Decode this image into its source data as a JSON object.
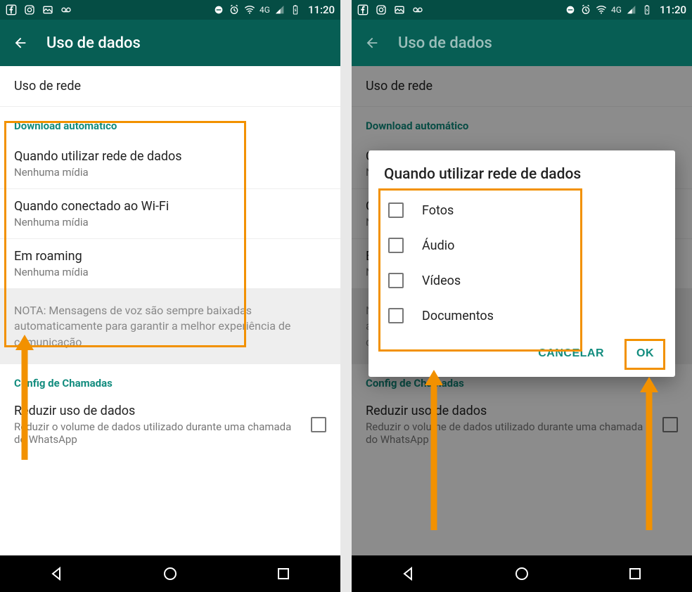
{
  "statusbar": {
    "net": "4G",
    "time": "11:20"
  },
  "appbar": {
    "title": "Uso de dados"
  },
  "left": {
    "network_usage": "Uso de rede",
    "section_download": "Download automático",
    "opt_data": {
      "title": "Quando utilizar rede de dados",
      "sub": "Nenhuma mídia"
    },
    "opt_wifi": {
      "title": "Quando conectado ao Wi-Fi",
      "sub": "Nenhuma mídia"
    },
    "opt_roaming": {
      "title": "Em roaming",
      "sub": "Nenhuma mídia"
    },
    "note": "NOTA: Mensagens de voz são sempre baixadas automaticamente para garantir a melhor experiência de comunicação",
    "section_calls": "Config de Chamadas",
    "reduce": {
      "title": "Reduzir uso de dados",
      "sub": "Reduzir o volume de dados utilizado durante uma chamada do WhatsApp"
    }
  },
  "dialog": {
    "title": "Quando utilizar rede de dados",
    "opts": {
      "photos": "Fotos",
      "audio": "Áudio",
      "videos": "Vídeos",
      "docs": "Documentos"
    },
    "cancel": "CANCELAR",
    "ok": "OK"
  }
}
